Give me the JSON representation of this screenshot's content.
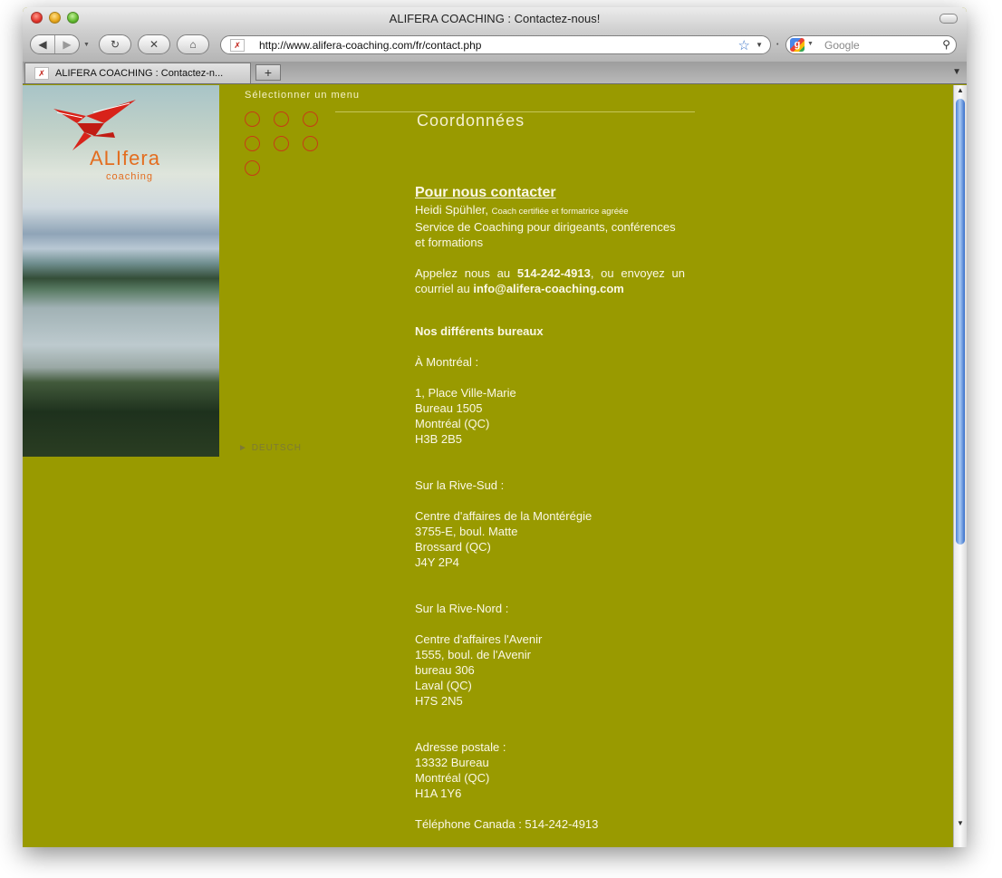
{
  "window": {
    "title": "ALIFERA COACHING : Contactez-nous!"
  },
  "toolbar": {
    "url": "http://www.alifera-coaching.com/fr/contact.php",
    "search_placeholder": "Google"
  },
  "tabs": [
    {
      "label": "ALIFERA COACHING : Contactez-n..."
    }
  ],
  "sidebar": {
    "brand_name": "ALIfera",
    "brand_sub": "coaching",
    "menu_label": "Sélectionner un menu",
    "lang_link": "DEUTSCH"
  },
  "main": {
    "section_title": "Coordonnées",
    "contact_heading": "Pour nous contacter",
    "person_name": "Heidi Spühler,",
    "person_title": "Coach certifiée et formatrice agréée",
    "service": "Service de Coaching pour dirigeants, conférences et formations",
    "call_prefix": "Appelez nous au",
    "phone": "514-242-4913",
    "call_mid": ", ou envoyez un courriel au",
    "email": "info@alifera-coaching.com",
    "offices_heading": "Nos différents bureaux",
    "offices": [
      {
        "region": "À Montréal :",
        "lines": [
          "1, Place Ville-Marie",
          "Bureau 1505",
          "Montréal (QC)",
          "H3B 2B5"
        ]
      },
      {
        "region": "Sur la Rive-Sud :",
        "lines": [
          "Centre d'affaires de la Montérégie",
          "3755-E, boul. Matte",
          "Brossard (QC)",
          "J4Y 2P4"
        ]
      },
      {
        "region": "Sur la Rive-Nord :",
        "lines": [
          "Centre d'affaires l'Avenir",
          "1555, boul. de l'Avenir",
          "bureau 306",
          "Laval (QC)",
          "H7S 2N5"
        ]
      }
    ],
    "postal_label": "Adresse postale :",
    "postal_lines": [
      "13332 Bureau",
      "Montréal (QC)",
      "H1A 1Y6"
    ],
    "phone_canada": "Téléphone Canada : 514-242-4913"
  },
  "colors": {
    "page_bg": "#999a00",
    "brand_orange": "#e36d1f",
    "circle_red": "#c63c16"
  },
  "icons": [
    "back-icon",
    "forward-icon",
    "reload-icon",
    "stop-icon",
    "home-icon",
    "bookmark-star-icon",
    "search-icon",
    "bird-logo-icon",
    "arrow-icon"
  ]
}
